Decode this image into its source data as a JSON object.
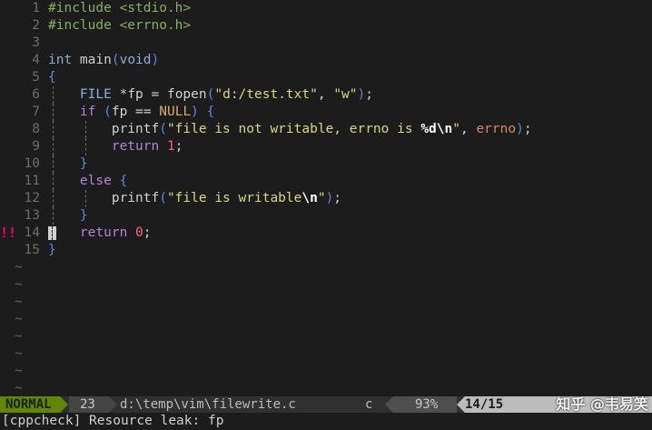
{
  "editor": {
    "lines": [
      {
        "num": "1",
        "sign": "",
        "tokens": [
          [
            "pre",
            "#include"
          ],
          [
            "plain",
            " "
          ],
          [
            "pre",
            "<stdio.h>"
          ]
        ]
      },
      {
        "num": "2",
        "sign": "",
        "tokens": [
          [
            "pre",
            "#include"
          ],
          [
            "plain",
            " "
          ],
          [
            "pre",
            "<errno.h>"
          ]
        ]
      },
      {
        "num": "3",
        "sign": "",
        "tokens": []
      },
      {
        "num": "4",
        "sign": "",
        "tokens": [
          [
            "type",
            "int"
          ],
          [
            "plain",
            " main"
          ],
          [
            "br",
            "("
          ],
          [
            "type",
            "void"
          ],
          [
            "br",
            ")"
          ]
        ]
      },
      {
        "num": "5",
        "sign": "",
        "tokens": [
          [
            "br",
            "{"
          ]
        ]
      },
      {
        "num": "6",
        "sign": "",
        "guides": [
          1
        ],
        "tokens": [
          [
            "plain",
            "    "
          ],
          [
            "type",
            "FILE"
          ],
          [
            "plain",
            " "
          ],
          [
            "op",
            "*"
          ],
          [
            "var",
            "fp = fopen"
          ],
          [
            "br",
            "("
          ],
          [
            "str",
            "\"d:/test.txt\""
          ],
          [
            "plain",
            ", "
          ],
          [
            "str",
            "\"w\""
          ],
          [
            "br",
            ")"
          ],
          [
            "plain",
            ";"
          ]
        ]
      },
      {
        "num": "7",
        "sign": "",
        "guides": [
          1
        ],
        "tokens": [
          [
            "plain",
            "    "
          ],
          [
            "kw",
            "if"
          ],
          [
            "plain",
            " "
          ],
          [
            "br",
            "("
          ],
          [
            "var",
            "fp == "
          ],
          [
            "con",
            "NULL"
          ],
          [
            "br",
            ")"
          ],
          [
            "plain",
            " "
          ],
          [
            "br",
            "{"
          ]
        ]
      },
      {
        "num": "8",
        "sign": "",
        "guides": [
          1,
          2
        ],
        "tokens": [
          [
            "plain",
            "        printf"
          ],
          [
            "br",
            "("
          ],
          [
            "str",
            "\"file is not writable, errno is "
          ],
          [
            "esc",
            "%d\\n"
          ],
          [
            "str",
            "\""
          ],
          [
            "plain",
            ", "
          ],
          [
            "errno",
            "errno"
          ],
          [
            "br",
            ")"
          ],
          [
            "plain",
            ";"
          ]
        ]
      },
      {
        "num": "9",
        "sign": "",
        "guides": [
          1,
          2
        ],
        "tokens": [
          [
            "plain",
            "        "
          ],
          [
            "kw",
            "return"
          ],
          [
            "plain",
            " "
          ],
          [
            "num",
            "1"
          ],
          [
            "plain",
            ";"
          ]
        ]
      },
      {
        "num": "10",
        "sign": "",
        "guides": [
          1
        ],
        "tokens": [
          [
            "plain",
            "    "
          ],
          [
            "br",
            "}"
          ]
        ]
      },
      {
        "num": "11",
        "sign": "",
        "guides": [
          1
        ],
        "tokens": [
          [
            "plain",
            "    "
          ],
          [
            "kw",
            "else"
          ],
          [
            "plain",
            " "
          ],
          [
            "br",
            "{"
          ]
        ]
      },
      {
        "num": "12",
        "sign": "",
        "guides": [
          1,
          2
        ],
        "tokens": [
          [
            "plain",
            "        printf"
          ],
          [
            "br",
            "("
          ],
          [
            "str",
            "\"file is writable"
          ],
          [
            "esc",
            "\\n"
          ],
          [
            "str",
            "\""
          ],
          [
            "br",
            ")"
          ],
          [
            "plain",
            ";"
          ]
        ]
      },
      {
        "num": "13",
        "sign": "",
        "guides": [
          1
        ],
        "tokens": [
          [
            "plain",
            "    "
          ],
          [
            "br",
            "}"
          ]
        ]
      },
      {
        "num": "14",
        "sign": "!!",
        "cursor": true,
        "tokens": [
          [
            "plain",
            "    "
          ],
          [
            "kw",
            "return"
          ],
          [
            "plain",
            " "
          ],
          [
            "num",
            "0"
          ],
          [
            "plain",
            ";"
          ]
        ]
      },
      {
        "num": "15",
        "sign": "",
        "tokens": [
          [
            "br",
            "}"
          ]
        ]
      }
    ],
    "empty_marker": "~",
    "empty_lines": 9
  },
  "status": {
    "mode": "NORMAL",
    "line_count": "23",
    "file_path": "d:\\temp\\vim\\filewrite.c",
    "file_type": "c",
    "percent": "93%",
    "position": "14/15",
    "watermark": "知乎 @韦易笑"
  },
  "cmdline": {
    "message": "[cppcheck] Resource leak: fp"
  },
  "colors": {
    "background": "#1c1c1c",
    "mode_bg": "#5f8700",
    "sign_error": "#ff005f",
    "string": "#d7d787",
    "keyword": "#af87d7",
    "type": "#87afd7",
    "preproc": "#87af5f",
    "number": "#ff5f87"
  }
}
